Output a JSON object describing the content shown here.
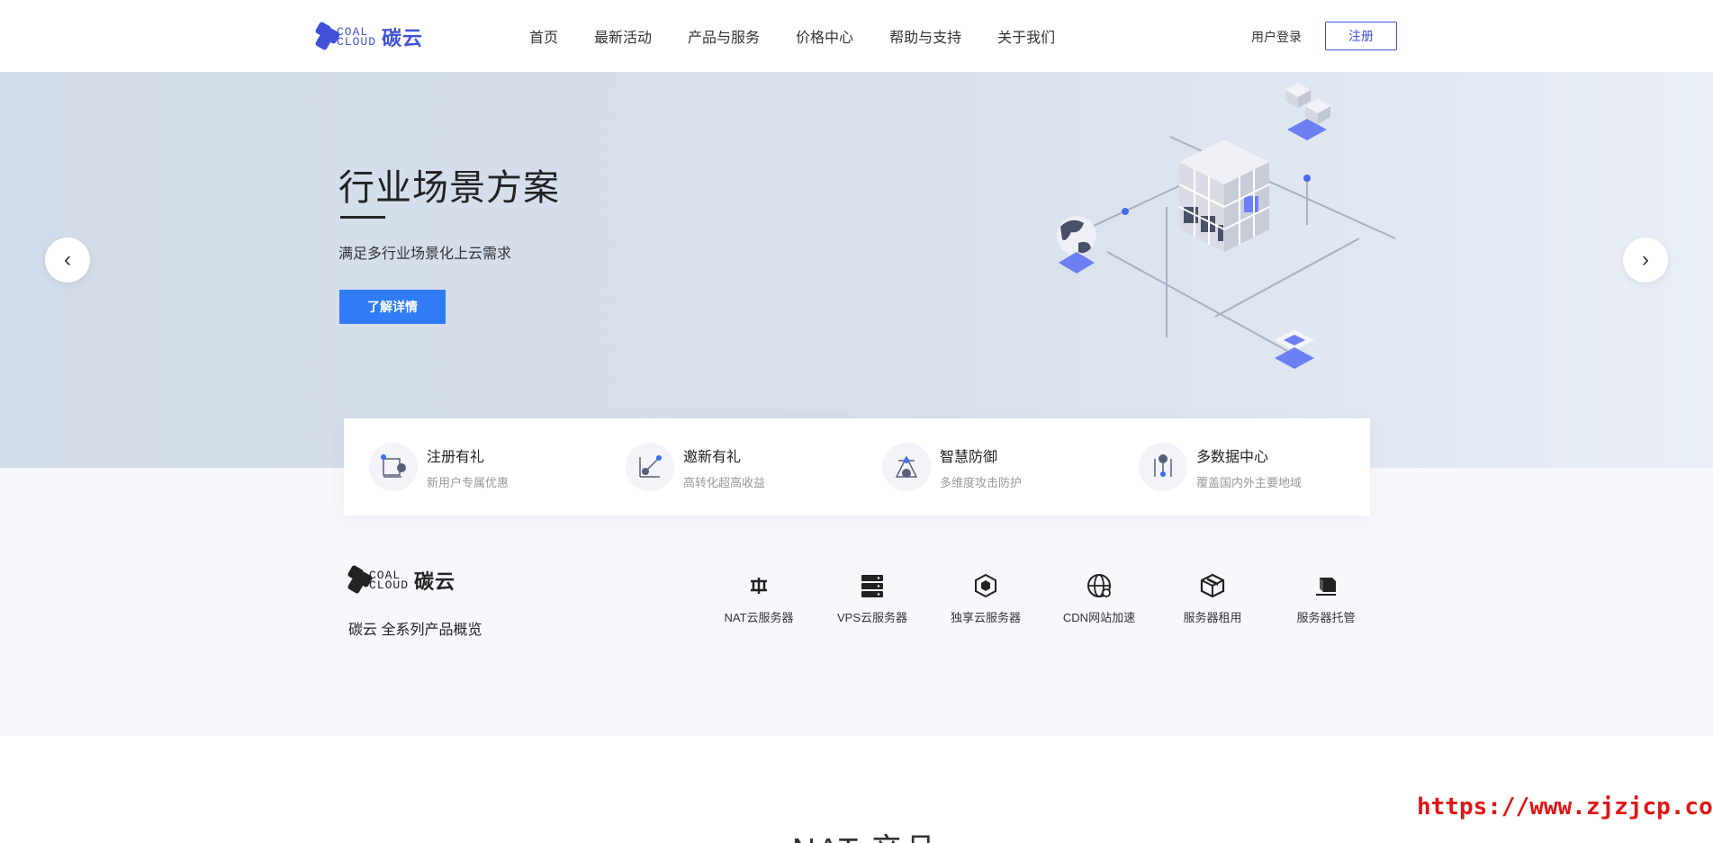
{
  "header": {
    "logo_text_top": "COAL",
    "logo_text_bottom": "CLOUD",
    "logo_cn": "碳云",
    "nav": [
      "首页",
      "最新活动",
      "产品与服务",
      "价格中心",
      "帮助与支持",
      "关于我们"
    ],
    "login": "用户登录",
    "register": "注册"
  },
  "banner": {
    "title": "行业场景方案",
    "subtitle": "满足多行业场景化上云需求",
    "button": "了解详情",
    "prev_icon": "chevron-left-icon",
    "next_icon": "chevron-right-icon"
  },
  "features": [
    {
      "title": "注册有礼",
      "desc": "新用户专属优惠",
      "icon": "gift-icon"
    },
    {
      "title": "邀新有礼",
      "desc": "高转化超高收益",
      "icon": "invite-icon"
    },
    {
      "title": "智慧防御",
      "desc": "多维度攻击防护",
      "icon": "shield-icon"
    },
    {
      "title": "多数据中心",
      "desc": "覆盖国内外主要地域",
      "icon": "datacenter-icon"
    }
  ],
  "overview": {
    "logo_text_top": "COAL",
    "logo_text_bottom": "CLOUD",
    "logo_cn": "碳云",
    "subtitle": "碳云 全系列产品概览",
    "products": [
      {
        "label": "NAT云服务器",
        "icon": "nat-icon"
      },
      {
        "label": "VPS云服务器",
        "icon": "server-stack-icon"
      },
      {
        "label": "独享云服务器",
        "icon": "cube-icon"
      },
      {
        "label": "CDN网站加速",
        "icon": "globe-icon"
      },
      {
        "label": "服务器租用",
        "icon": "box-icon"
      },
      {
        "label": "服务器托管",
        "icon": "hosting-icon"
      }
    ]
  },
  "section": {
    "title": "NAT 产品"
  },
  "watermark": "https://www.zjzjcp.com",
  "colors": {
    "brand": "#3f52d8",
    "button": "#2f7cf6",
    "banner_bg": "#d3dcea"
  }
}
